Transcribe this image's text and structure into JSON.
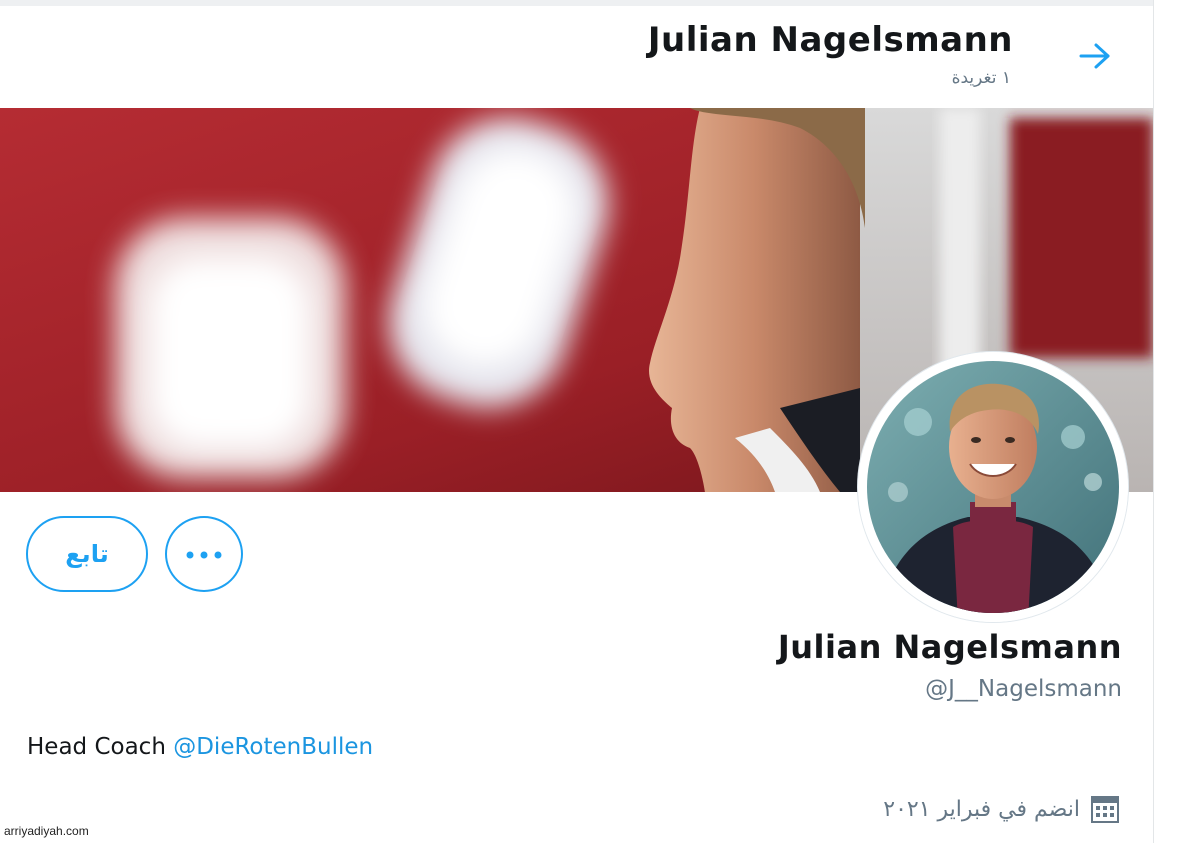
{
  "header": {
    "title": "Julian Nagelsmann",
    "tweet_count": "١ تغريدة",
    "back_icon": "arrow-right-icon"
  },
  "profile": {
    "name": "Julian Nagelsmann",
    "handle": "@J__Nagelsmann",
    "bio_text": "Head Coach ",
    "bio_link": "@DieRotenBullen",
    "joined": "انضم في فبراير ٢٠٢١",
    "joined_icon": "calendar-icon"
  },
  "actions": {
    "follow_label": "تابع",
    "more_icon": "more-dots-icon"
  },
  "watermark": "arriyadiyah.com",
  "colors": {
    "accent": "#1da1f2",
    "text_primary": "#14171a",
    "text_secondary": "#657786",
    "banner_red": "#a8232a"
  }
}
